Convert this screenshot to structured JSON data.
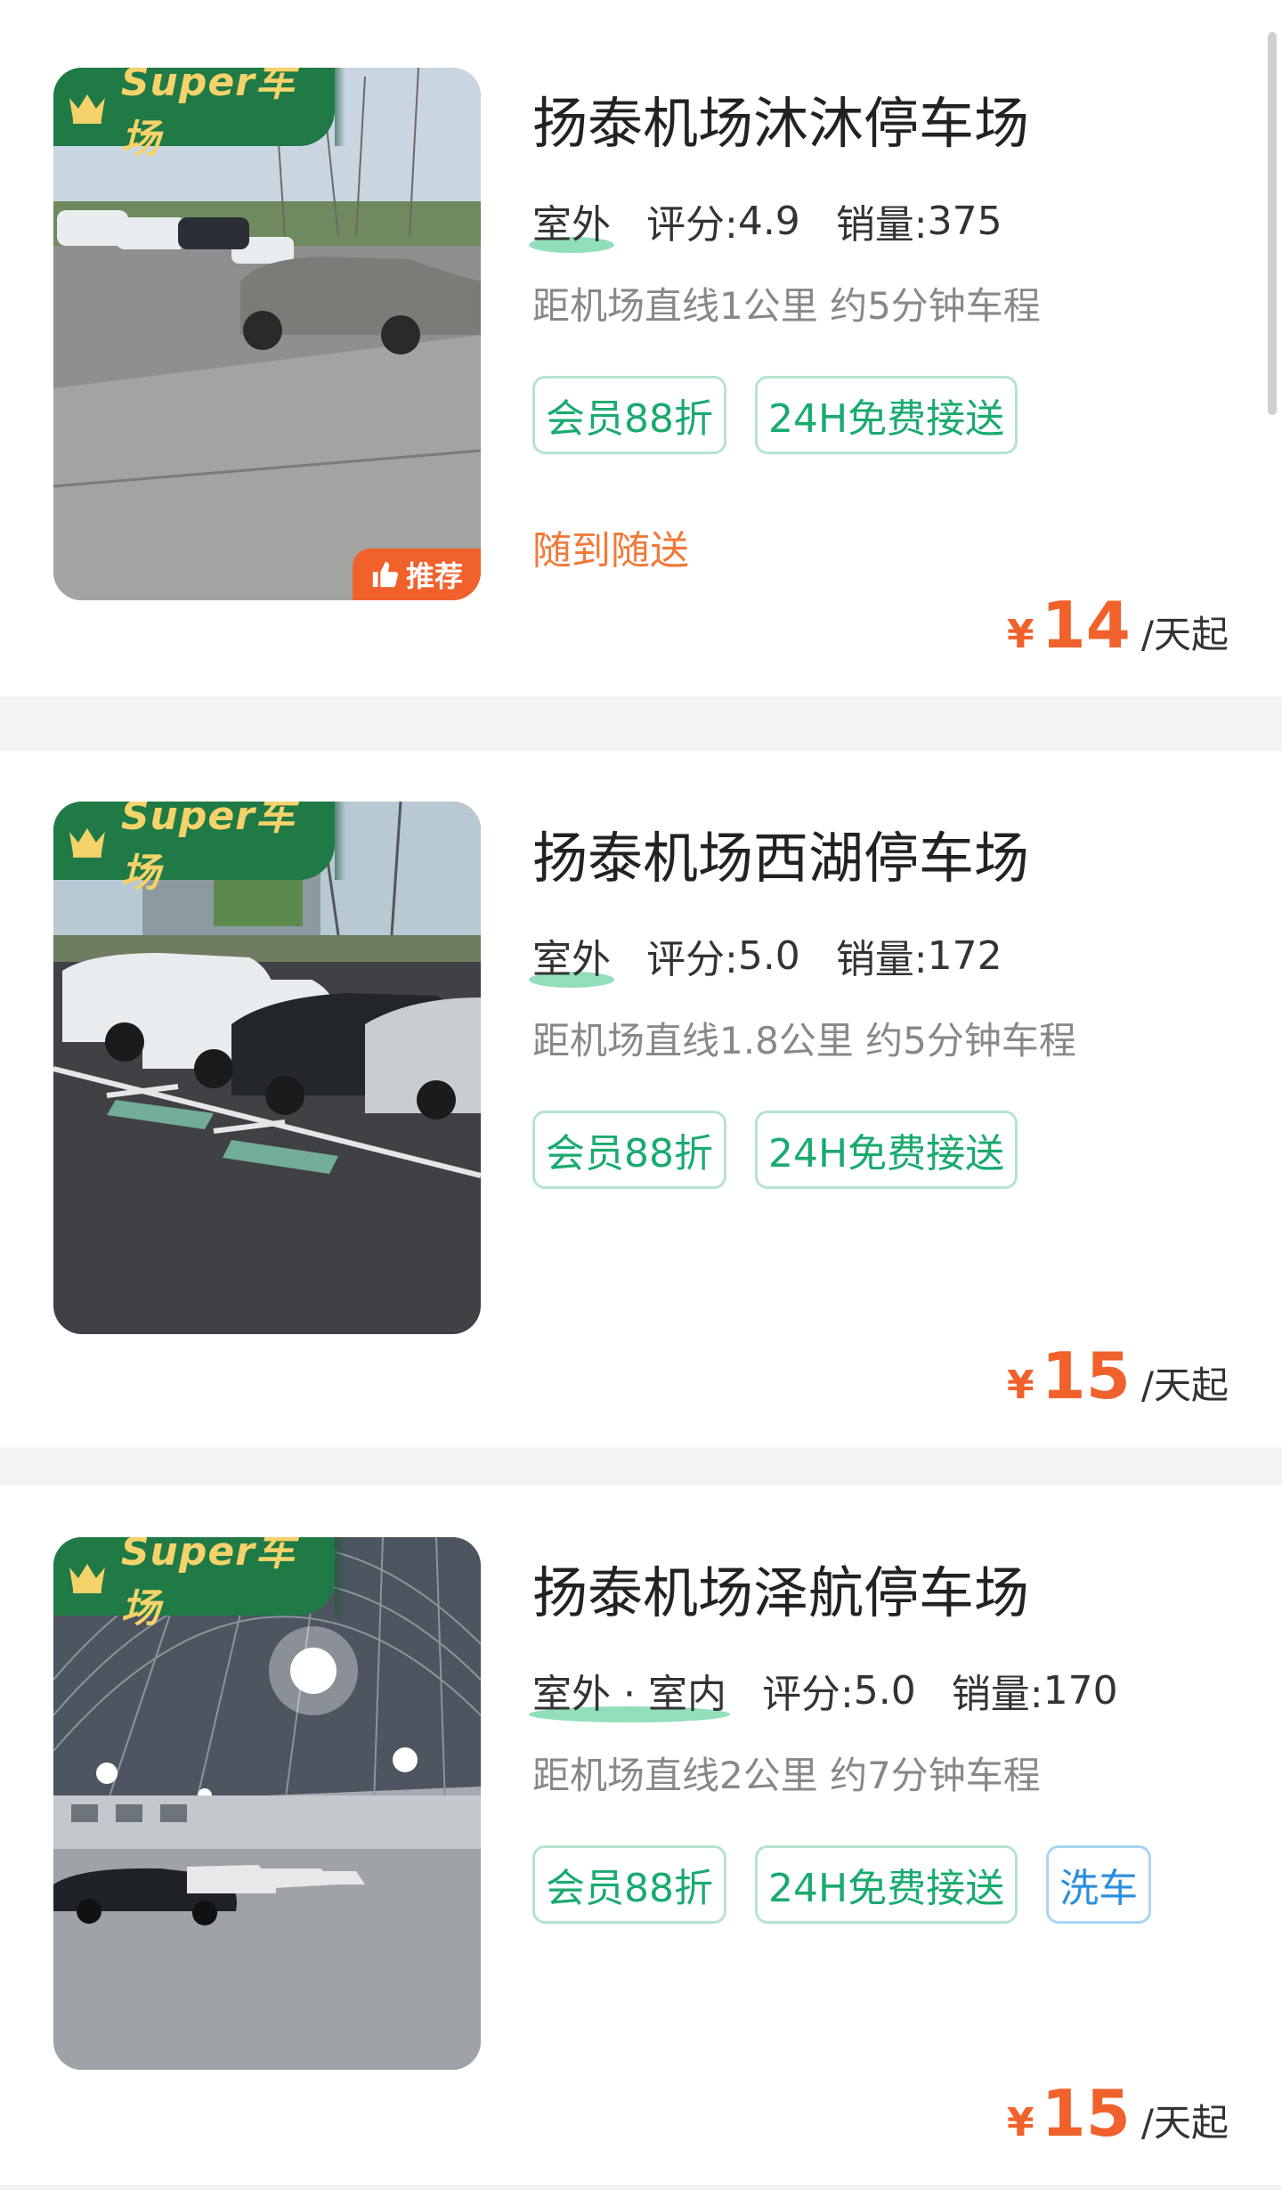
{
  "badges": {
    "super": "Super车场",
    "recommend": "推荐"
  },
  "lots": [
    {
      "name": "扬泰机场沐沐停车场",
      "location_type": "室外",
      "rating_label": "评分:",
      "rating": "4.9",
      "sales_label": "销量:",
      "sales": "375",
      "distance": "距机场直线1公里 约5分钟车程",
      "tags": [
        "会员88折",
        "24H免费接送"
      ],
      "note": "随到随送",
      "recommended": true,
      "price_currency": "¥",
      "price": "14",
      "price_unit": "/天起"
    },
    {
      "name": "扬泰机场西湖停车场",
      "location_type": "室外",
      "rating_label": "评分:",
      "rating": "5.0",
      "sales_label": "销量:",
      "sales": "172",
      "distance": "距机场直线1.8公里 约5分钟车程",
      "tags": [
        "会员88折",
        "24H免费接送"
      ],
      "note": "",
      "recommended": false,
      "price_currency": "¥",
      "price": "15",
      "price_unit": "/天起"
    },
    {
      "name": "扬泰机场泽航停车场",
      "location_type": "室外 · 室内",
      "rating_label": "评分:",
      "rating": "5.0",
      "sales_label": "销量:",
      "sales": "170",
      "distance": "距机场直线2公里 约7分钟车程",
      "tags": [
        "会员88折",
        "24H免费接送"
      ],
      "extra_tag": "洗车",
      "note": "",
      "recommended": false,
      "price_currency": "¥",
      "price": "15",
      "price_unit": "/天起"
    }
  ],
  "colors": {
    "accent_green": "#1aaa70",
    "price_orange": "#f0612b",
    "badge_green": "#1f7a45",
    "tag_blue": "#2c8fdc"
  }
}
